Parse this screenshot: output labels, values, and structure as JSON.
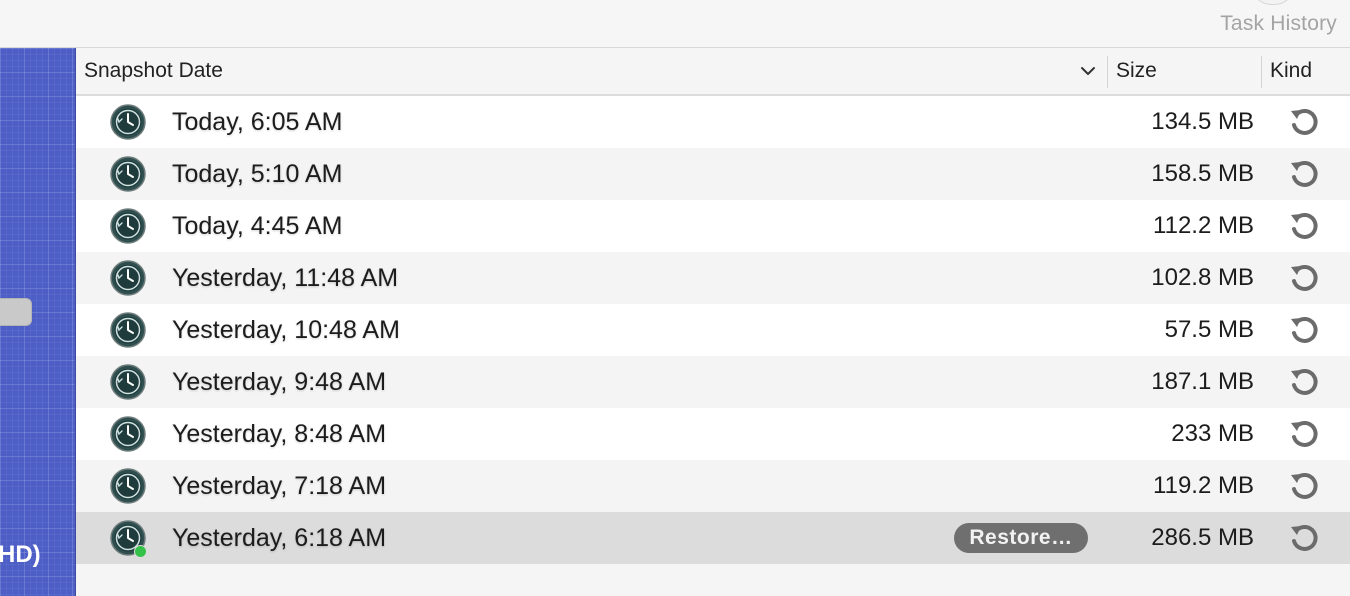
{
  "toolbar": {
    "task_history_label": "Task History"
  },
  "sidebar": {
    "volume_label_fragment": "HD)",
    "accent_color": "#4d5fc7"
  },
  "table": {
    "columns": {
      "date": "Snapshot Date",
      "size": "Size",
      "kind": "Kind"
    },
    "sort_indicator": "chevron-down-icon",
    "restore_label": "Restore…",
    "rows": [
      {
        "date": "Today, 6:05 AM",
        "size": "134.5 MB",
        "kind_icon": "restore-arrow-icon",
        "selected": false
      },
      {
        "date": "Today, 5:10 AM",
        "size": "158.5 MB",
        "kind_icon": "restore-arrow-icon",
        "selected": false
      },
      {
        "date": "Today, 4:45 AM",
        "size": "112.2 MB",
        "kind_icon": "restore-arrow-icon",
        "selected": false
      },
      {
        "date": "Yesterday, 11:48 AM",
        "size": "102.8 MB",
        "kind_icon": "restore-arrow-icon",
        "selected": false
      },
      {
        "date": "Yesterday, 10:48 AM",
        "size": "57.5 MB",
        "kind_icon": "restore-arrow-icon",
        "selected": false
      },
      {
        "date": "Yesterday, 9:48 AM",
        "size": "187.1 MB",
        "kind_icon": "restore-arrow-icon",
        "selected": false
      },
      {
        "date": "Yesterday, 8:48 AM",
        "size": "233 MB",
        "kind_icon": "restore-arrow-icon",
        "selected": false
      },
      {
        "date": "Yesterday, 7:18 AM",
        "size": "119.2 MB",
        "kind_icon": "restore-arrow-icon",
        "selected": false
      },
      {
        "date": "Yesterday, 6:18 AM",
        "size": "286.5 MB",
        "kind_icon": "restore-arrow-icon",
        "selected": true
      }
    ],
    "status_dot_color": "#35c24a"
  }
}
